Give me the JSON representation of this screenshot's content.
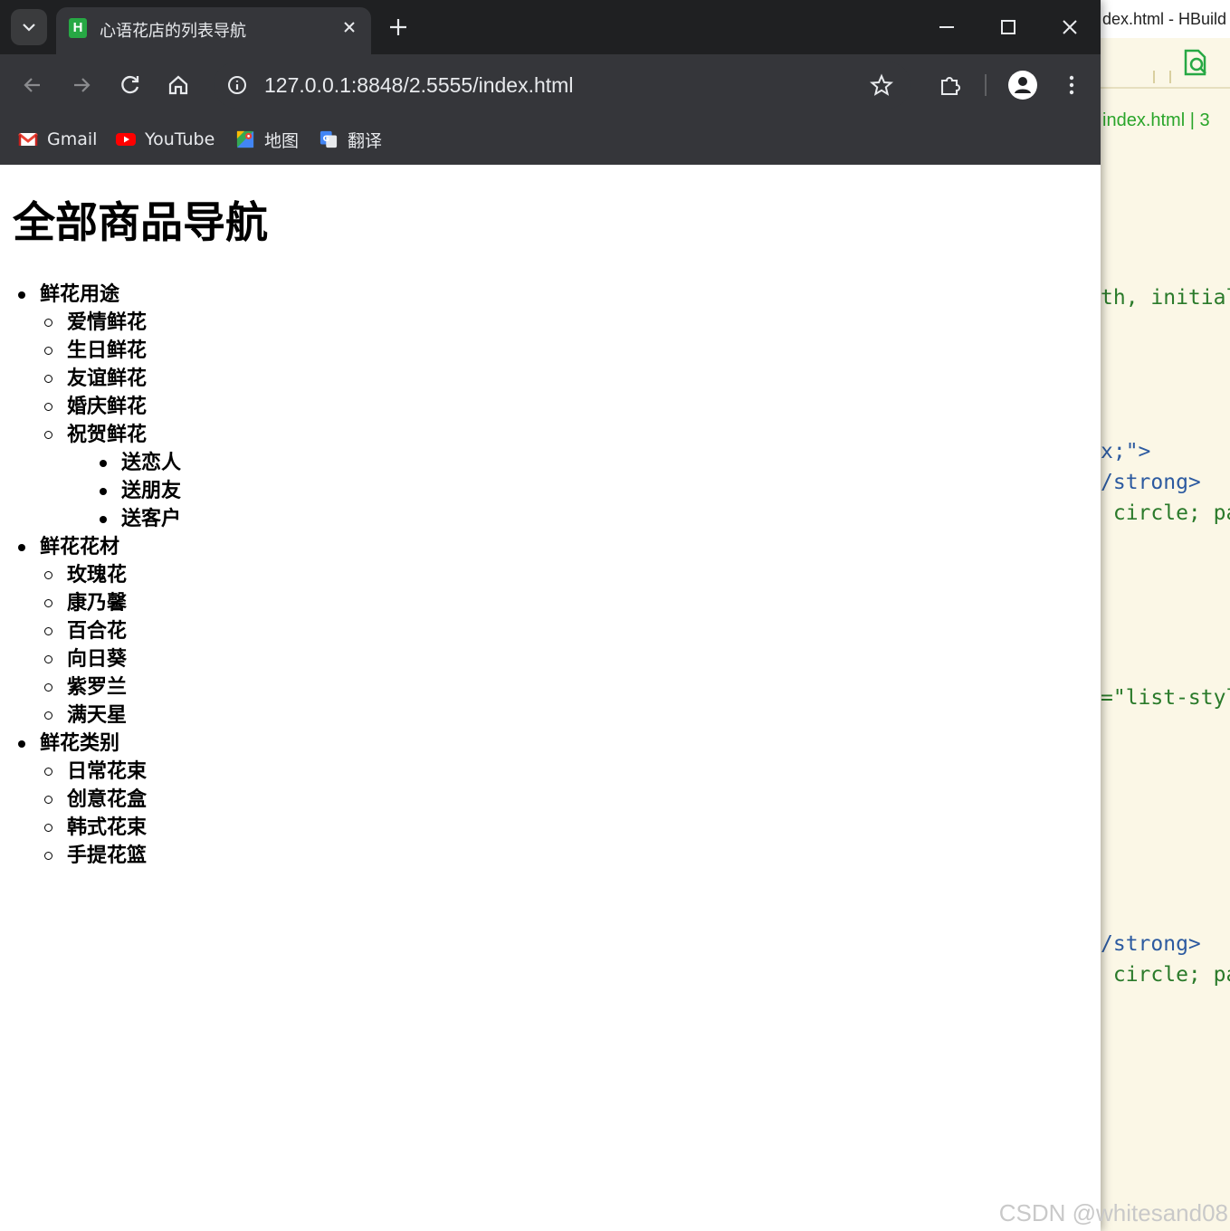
{
  "editor": {
    "title_fragment": "dex.html - HBuild",
    "tab_label": "index.html | 3",
    "code_lines": [
      {
        "text": "th, initial",
        "class": "c-attr"
      },
      {
        "text": "x;\">",
        "class": "c-tag"
      },
      {
        "text": "/strong>",
        "class": "c-tag"
      },
      {
        "text": " circle; pa",
        "class": "c-attr"
      },
      {
        "text": "=\"list-styl",
        "class": "c-attr"
      },
      {
        "text": "/strong>",
        "class": "c-tag"
      },
      {
        "text": " circle; pa",
        "class": "c-attr"
      }
    ],
    "watermark": "CSDN @whitesand08"
  },
  "browser": {
    "tab": {
      "favicon_letter": "H",
      "title": "心语花店的列表导航"
    },
    "address": {
      "url": "127.0.0.1:8848/2.5555/index.html"
    },
    "bookmarks": [
      {
        "label": "Gmail",
        "icon": "gmail-icon"
      },
      {
        "label": "YouTube",
        "icon": "youtube-icon"
      },
      {
        "label": "地图",
        "icon": "maps-icon"
      },
      {
        "label": "翻译",
        "icon": "translate-icon"
      }
    ]
  },
  "page": {
    "title": "全部商品导航",
    "categories": [
      {
        "label": "鲜花用途",
        "items": [
          {
            "label": "爱情鲜花"
          },
          {
            "label": "生日鲜花"
          },
          {
            "label": "友谊鲜花"
          },
          {
            "label": "婚庆鲜花"
          },
          {
            "label": "祝贺鲜花",
            "children": [
              "送恋人",
              "送朋友",
              "送客户"
            ]
          }
        ]
      },
      {
        "label": "鲜花花材",
        "items": [
          {
            "label": "玫瑰花"
          },
          {
            "label": "康乃馨"
          },
          {
            "label": "百合花"
          },
          {
            "label": "向日葵"
          },
          {
            "label": "紫罗兰"
          },
          {
            "label": "满天星"
          }
        ]
      },
      {
        "label": "鲜花类别",
        "items": [
          {
            "label": "日常花束"
          },
          {
            "label": "创意花盒"
          },
          {
            "label": "韩式花束"
          },
          {
            "label": "手提花篮"
          }
        ]
      }
    ]
  },
  "colors": {
    "tabstrip_bg": "#1f2022",
    "toolbar_bg": "#35363a",
    "editor_bg": "#fbf7e6",
    "editor_tab_text": "#2aa52a"
  }
}
